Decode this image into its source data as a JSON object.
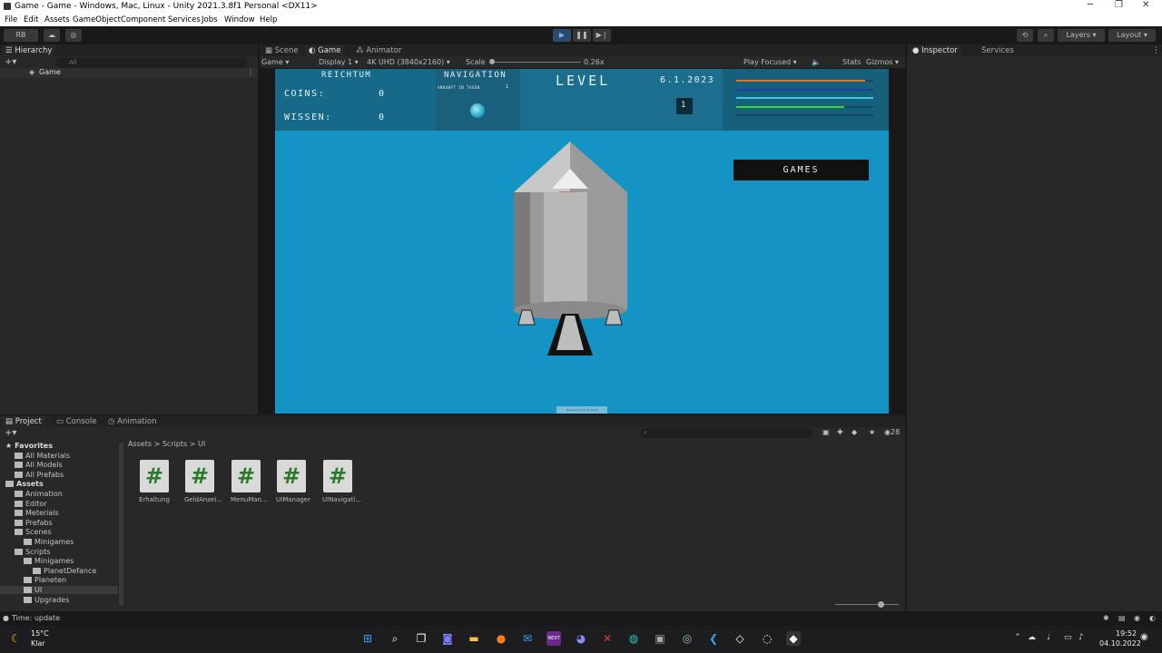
{
  "window": {
    "title": "Game - Game - Windows, Mac, Linux - Unity 2021.3.8f1 Personal <DX11>"
  },
  "menu": [
    "File",
    "Edit",
    "Assets",
    "GameObject",
    "Component",
    "Services",
    "Jobs",
    "Window",
    "Help"
  ],
  "toolbar": {
    "account": "RB",
    "layers": "Layers",
    "layout": "Layout"
  },
  "hierarchy": {
    "tab": "Hierarchy",
    "search_placeholder": "All",
    "scene": "Game"
  },
  "viewtabs": [
    "Scene",
    "Game",
    "Animator"
  ],
  "gamebar": {
    "mode": "Game",
    "display": "Display 1",
    "resolution": "4K UHD (3840x2160)",
    "scale_label": "Scale",
    "scale": "0.26x",
    "play": "Play Focused",
    "stats": "Stats",
    "gizmos": "Gizmos"
  },
  "game": {
    "reichtum": "REICHTUM",
    "coins_label": "COINS:",
    "coins": "0",
    "wissen_label": "WISSEN:",
    "wissen": "0",
    "navigation": "NAVIGATION",
    "arrival": "ANKUNFT IN TAGEN",
    "arrival_value": "1",
    "level": "LEVEL",
    "date": "6.1.2023",
    "level_value": "1",
    "games": "GAMES",
    "status_bars": [
      {
        "color": "#e0741c",
        "fill": 0.94
      },
      {
        "color": "#1d3fa8",
        "fill": 0.97
      },
      {
        "color": "#3fc7e0",
        "fill": 1.0
      },
      {
        "color": "#3fd62a",
        "fill": 0.79
      },
      {
        "color": "#3fa050",
        "fill": 0.0
      }
    ],
    "bottom_label": "Powered by Unity Tools"
  },
  "inspector": {
    "tab1": "Inspector",
    "tab2": "Services"
  },
  "project": {
    "tabs": [
      "Project",
      "Console",
      "Animation"
    ],
    "badge": "28",
    "breadcrumb": [
      "Assets",
      "Scripts",
      "UI"
    ],
    "tree": [
      {
        "label": "Favorites",
        "level": 0,
        "bold": true
      },
      {
        "label": "All Materials",
        "level": 1
      },
      {
        "label": "All Models",
        "level": 1
      },
      {
        "label": "All Prefabs",
        "level": 1
      },
      {
        "label": "Assets",
        "level": 0,
        "bold": true
      },
      {
        "label": "Animation",
        "level": 1
      },
      {
        "label": "Editor",
        "level": 1
      },
      {
        "label": "Meterials",
        "level": 1
      },
      {
        "label": "Prefabs",
        "level": 1
      },
      {
        "label": "Scenes",
        "level": 1
      },
      {
        "label": "Minigames",
        "level": 2
      },
      {
        "label": "Scripts",
        "level": 1
      },
      {
        "label": "Minigames",
        "level": 2
      },
      {
        "label": "PlanetDefance",
        "level": 3
      },
      {
        "label": "Planeten",
        "level": 2
      },
      {
        "label": "UI",
        "level": 2,
        "selected": true
      },
      {
        "label": "Upgrades",
        "level": 2
      }
    ],
    "assets": [
      "Erhaltung",
      "GeldAnzei...",
      "MenuMan...",
      "UIManager",
      "UINavigati..."
    ]
  },
  "status": {
    "text": "Time: update"
  },
  "taskbar": {
    "temp": "15°C",
    "weather": "Klar",
    "time": "19:52",
    "date": "04.10.2022"
  }
}
